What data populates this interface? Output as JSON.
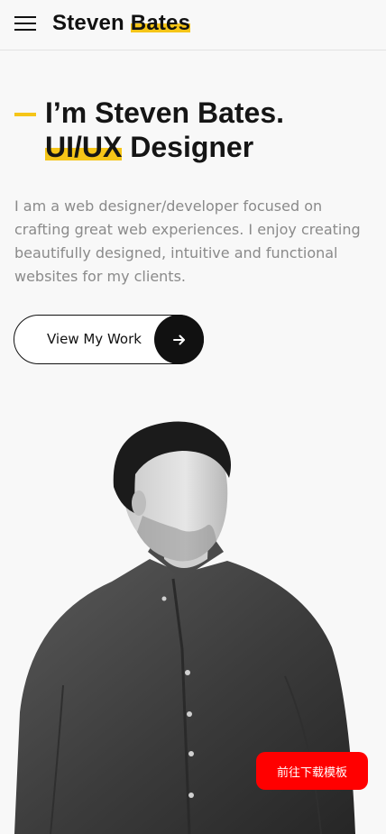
{
  "header": {
    "logo_first": "Steven",
    "logo_second": "Bates",
    "menu_icon": "hamburger-menu-icon"
  },
  "hero": {
    "title_line1": "I’m Steven Bates.",
    "role": "UI/UX",
    "title_line2_rest": " Designer",
    "intro": "I am a web designer/developer focused on crafting great web experiences. I enjoy creating beautifully designed, intuitive and functional websites for my clients.",
    "cta_label": "View My Work",
    "cta_icon": "arrow-right-icon"
  },
  "floating_button": {
    "label": "前往下载模板"
  },
  "colors": {
    "accent": "#f5c518",
    "text": "#111111",
    "muted": "#8a8a8a",
    "download": "#ff0000"
  }
}
